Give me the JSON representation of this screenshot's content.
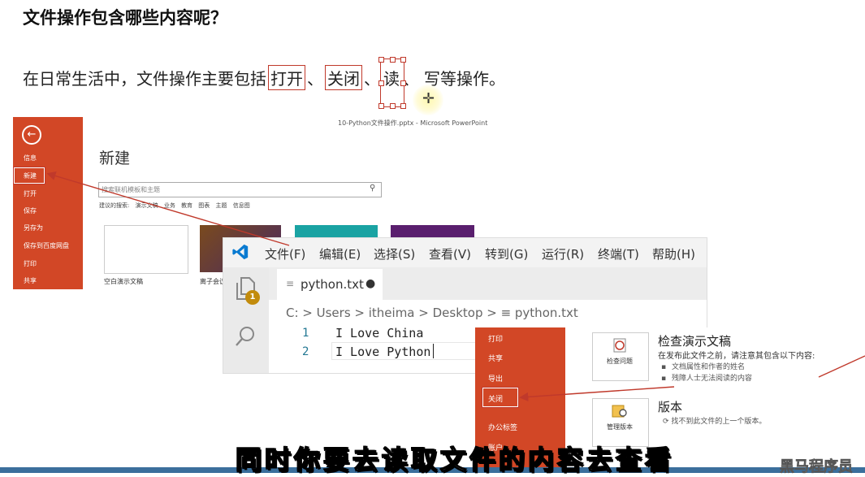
{
  "slide": {
    "title": "文件操作包含哪些内容呢？",
    "sentence_prefix": "在日常生活中，文件操作主要包括",
    "word_open": "打开",
    "sep1": "、",
    "word_close": "关闭",
    "sep2": "、",
    "word_read": "读",
    "sep3": "、",
    "word_write": "写",
    "sentence_suffix": "等操作。"
  },
  "ppt_backstage": {
    "window_title": "10-Python文件操作.pptx - Microsoft PowerPoint",
    "back_icon": "back-arrow-icon",
    "menu_items": [
      "信息",
      "新建",
      "打开",
      "保存",
      "另存为",
      "保存到百度网盘",
      "打印",
      "共享"
    ],
    "heading": "新建",
    "search_placeholder": "搜索联机模板和主题",
    "suggested_label": "建议的搜索:",
    "suggested_items": [
      "演示文稿",
      "业务",
      "教育",
      "图表",
      "主题",
      "信息图"
    ],
    "templates": [
      {
        "label": "空白演示文稿"
      },
      {
        "label": "离子会议"
      }
    ],
    "accent_color": "#d24726"
  },
  "vscode": {
    "menu": [
      "文件(F)",
      "编辑(E)",
      "选择(S)",
      "查看(V)",
      "转到(G)",
      "运行(R)",
      "终端(T)",
      "帮助(H)"
    ],
    "badge_count": "1",
    "tab": {
      "filename": "python.txt",
      "dirty_indicator": "●"
    },
    "breadcrumb": [
      "C:",
      "Users",
      "itheima",
      "Desktop",
      "python.txt"
    ],
    "breadcrumb_text": "C: > Users > itheima > Desktop > ≡ python.txt",
    "lines": [
      {
        "number": "1",
        "text": "I Love China"
      },
      {
        "number": "2",
        "text": "I Love Python"
      }
    ]
  },
  "ppt_info": {
    "menu_items": [
      "打印",
      "共享",
      "导出",
      "关闭",
      "办公标签",
      "账户"
    ],
    "inspect_button": "检查问题",
    "inspect_heading": "检查演示文稿",
    "inspect_desc": "在发布此文件之前，请注意其包含以下内容:",
    "inspect_bullets": [
      "文档属性和作者的姓名",
      "残障人士无法阅读的内容"
    ],
    "manage_button": "管理版本",
    "version_heading": "版本",
    "version_desc": "找不到此文件的上一个版本。"
  },
  "subtitle": "同时你要去读取文件的内容去查看",
  "watermark": "黑马程序员"
}
